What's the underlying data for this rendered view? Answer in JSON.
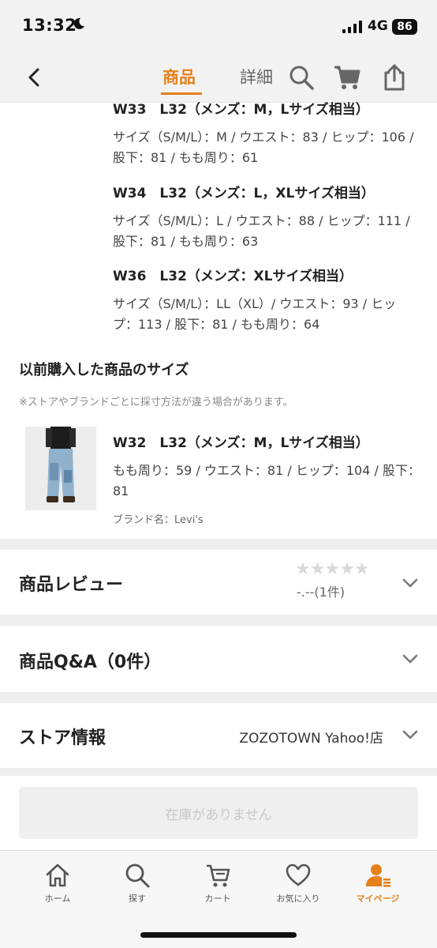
{
  "status_bar": {
    "time": "13:32",
    "network": "4G",
    "battery": "86"
  },
  "nav": {
    "tabs": [
      "商品",
      "詳細"
    ],
    "active_tab": "商品",
    "accent_color": "#e5801a",
    "icons": [
      "back-icon",
      "search-icon",
      "cart-icon",
      "share-icon"
    ]
  },
  "sizes": [
    {
      "title": "W33　L32（メンズ：M，Lサイズ相当）",
      "desc": "サイズ（S/M/L）：M / ウエスト：83 / ヒップ：106 / 股下：81 / もも周り：61"
    },
    {
      "title": "W34　L32（メンズ：L，XLサイズ相当）",
      "desc": "サイズ（S/M/L）：L / ウエスト：88 / ヒップ：111 / 股下：81 / もも周り：63"
    },
    {
      "title": "W36　L32（メンズ：XLサイズ相当）",
      "desc": "サイズ（S/M/L）：LL（XL）/ ウエスト：93 / ヒップ：113 / 股下：81 / もも周り：64"
    }
  ],
  "previous": {
    "heading": "以前購入した商品のサイズ",
    "note": "※ストアやブランドごとに採寸方法が違う場合があります。",
    "item": {
      "title": "W32　L32（メンズ：M，Lサイズ相当）",
      "desc": "もも周り：59 / ウエスト：81 / ヒップ：104 / 股下：81",
      "brand": "ブランド名：Levi's"
    }
  },
  "review": {
    "title": "商品レビュー",
    "score": "-.--",
    "count": "(1件)",
    "stars_filled": 0,
    "stars_total": 5
  },
  "qa": {
    "title": "商品Q&A（0件）"
  },
  "store": {
    "title": "ストア情報",
    "name": "ZOZOTOWN Yahoo!店"
  },
  "cta": {
    "label": "在庫がありません"
  },
  "tab_bar": {
    "items": [
      {
        "label": "ホーム",
        "icon": "home-icon"
      },
      {
        "label": "探す",
        "icon": "search-icon"
      },
      {
        "label": "カート",
        "icon": "cart-icon"
      },
      {
        "label": "お気に入り",
        "icon": "heart-icon"
      },
      {
        "label": "マイページ",
        "icon": "user-icon"
      }
    ],
    "active": "マイページ"
  }
}
